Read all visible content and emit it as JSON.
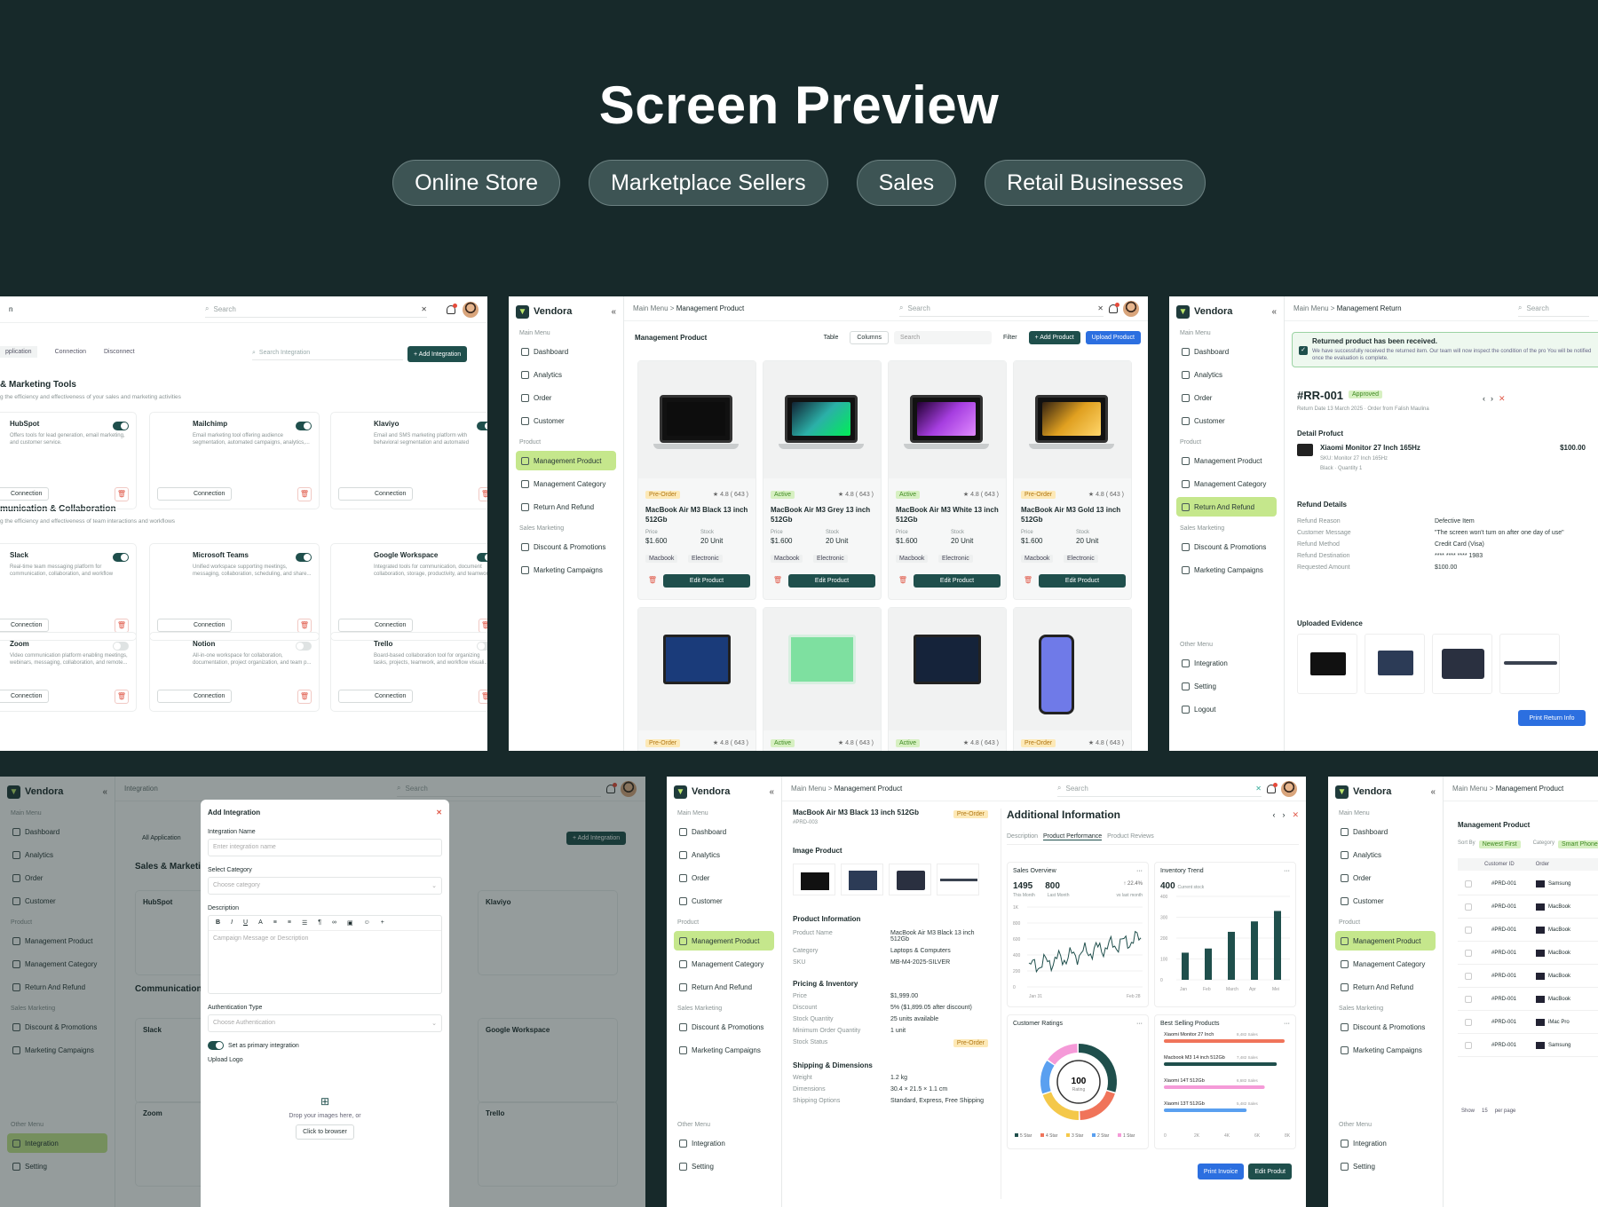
{
  "hero": {
    "title": "Screen Preview",
    "chips": [
      "Online Store",
      "Marketplace Sellers",
      "Sales",
      "Retail Businesses"
    ]
  },
  "brand": "Vendora",
  "nav": {
    "main_menu": "Main Menu",
    "dashboard": "Dashboard",
    "analytics": "Analytics",
    "order": "Order",
    "customer": "Customer",
    "product": "Product",
    "mgmt_product": "Management Product",
    "mgmt_category": "Management Category",
    "return_refund": "Return And Refund",
    "sales_marketing": "Sales Marketing",
    "discount": "Discount & Promotions",
    "campaigns": "Marketing Campaigns",
    "other_menu": "Other Menu",
    "integration": "Integration",
    "setting": "Setting",
    "logout": "Logout"
  },
  "search": "Search",
  "integrations": {
    "tabs": [
      "pplication",
      "Connection",
      "Disconnect"
    ],
    "search_placeholder": "Search Integration",
    "add_button": "+ Add Integration",
    "section1_title": "& Marketing Tools",
    "section1_desc": "g the efficiency and effectiveness of your sales and marketing activities",
    "section2_title": "munication & Collaboration",
    "section2_desc": "g the efficiency and effectiveness of team interactions and workflows",
    "connection_label": "Connection",
    "cards": [
      {
        "name": "HubSpot",
        "desc": "Offers tools for lead generation, email marketing, and customer service.",
        "on": true
      },
      {
        "name": "Mailchimp",
        "desc": "Email marketing tool offering audience segmentation, automated campaigns, analytics,...",
        "on": true
      },
      {
        "name": "Klaviyo",
        "desc": "Email and SMS marketing platform with behavioral segmentation and automated personalization.",
        "on": true
      },
      {
        "name": "Slack",
        "desc": "Real-time team messaging platform for communication, collaboration, and workflow coor...",
        "on": true
      },
      {
        "name": "Microsoft Teams",
        "desc": "Unified workspace supporting meetings, messaging, collaboration, scheduling, and share...",
        "on": true
      },
      {
        "name": "Google Workspace",
        "desc": "Integrated tools for communication, document collaboration, storage, productivity, and teamwor...",
        "on": true
      },
      {
        "name": "Zoom",
        "desc": "Video communication platform enabling meetings, webinars, messaging, collaboration, and remote...",
        "on": false
      },
      {
        "name": "Notion",
        "desc": "All-in-one workspace for collaboration, documentation, project organization, and team p...",
        "on": false
      },
      {
        "name": "Trello",
        "desc": "Board-based collaboration tool for organizing tasks, projects, teamwork, and workflow visuali...",
        "on": false
      }
    ]
  },
  "products": {
    "breadcrumb": "Main Menu",
    "current": "Management Product",
    "heading": "Management Product",
    "table": "Table",
    "columns": "Columns",
    "filter": "Filter",
    "add": "+ Add Product",
    "upload": "Upload Product",
    "edit": "Edit Product",
    "price_label": "Price",
    "stock_label": "Stock",
    "rating": "★ 4.8 ( 643 )",
    "items": [
      {
        "status": "Pre-Order",
        "name": "MacBook Air M3 Black 13 inch 512Gb",
        "price": "$1.600",
        "stock": "20 Unit",
        "tags": [
          "Macbook",
          "Electronic"
        ]
      },
      {
        "status": "Active",
        "name": "MacBook Air M3 Grey 13 inch 512Gb",
        "price": "$1.600",
        "stock": "20 Unit",
        "tags": [
          "Macbook",
          "Electronic"
        ]
      },
      {
        "status": "Active",
        "name": "MacBook Air M3 White 13 inch 512Gb",
        "price": "$1.600",
        "stock": "20 Unit",
        "tags": [
          "Macbook",
          "Electronic"
        ]
      },
      {
        "status": "Pre-Order",
        "name": "MacBook Air M3 Gold 13 inch 512Gb",
        "price": "$1.600",
        "stock": "20 Unit",
        "tags": [
          "Macbook",
          "Electronic"
        ]
      }
    ],
    "bottom_status": [
      "Pre-Order",
      "Active",
      "Active",
      "Pre-Order"
    ],
    "bottom_rating": "★ 4.8 ( 643 )"
  },
  "ret": {
    "current": "Management Return",
    "alert_title": "Returned product has been received.",
    "alert_body": "We have successfully received the returned item. Our team will now inspect the condition of the pro You will be notified once the evaluation is complete.",
    "id": "#RR-001",
    "status": "Approved",
    "meta": "Return Date  13 March 2025   ·   Order from  Falish Maulina",
    "detail_title": "Detail Profuct",
    "item": "Xiaomi Monitor 27 Inch 165Hz",
    "amount": "$100.00",
    "sku": "SKU: Monitor 27 Inch 165Hz",
    "variant": "Black  ·  Quantity 1",
    "refund_title": "Refund Details",
    "refund": [
      [
        "Refund Reason",
        "Defective Item"
      ],
      [
        "Customer Message",
        "\"The screen won't turn on after one day of use\""
      ],
      [
        "Refund Method",
        "Credit Card (Visa)"
      ],
      [
        "Refund Destination",
        "**** **** **** 1983"
      ],
      [
        "Requested Amount",
        "$100.00"
      ]
    ],
    "evidence": "Uploaded Evidence",
    "print": "Print Return Info"
  },
  "modal": {
    "bg_title": "Integration",
    "title": "Add Integration",
    "name_label": "Integration Name",
    "name_ph": "Enter integration name",
    "cat_label": "Select Category",
    "cat_ph": "Choose category",
    "desc_label": "Description",
    "desc_ph": "Campaign Message or Description",
    "auth_label": "Authentication Type",
    "auth_ph": "Choose Authentication",
    "primary": "Set as primary integration",
    "logo_label": "Upload Logo",
    "drop": "Drop your images here, or",
    "browse": "Click to browser",
    "bg_sales": "Sales & Marketi",
    "bg_comm": "Communication",
    "bg_all": "All Application"
  },
  "detail": {
    "product": "MacBook Air M3 Black 13 inch 512Gb",
    "code": "#PRD-003",
    "status": "Pre-Order",
    "image_title": "Image Product",
    "info_title": "Product Information",
    "info": [
      [
        "Product Name",
        "MacBook Air M3 Black 13 inch 512Gb"
      ],
      [
        "Category",
        "Laptops & Computers"
      ],
      [
        "SKU",
        "MB-M4-2025-SILVER"
      ]
    ],
    "pricing_title": "Pricing & Inventory",
    "pricing": [
      [
        "Price",
        "$1,999.00"
      ],
      [
        "Discount",
        "5% ($1,899.05 after discount)"
      ],
      [
        "Stock Quantity",
        "25 units available"
      ],
      [
        "Minimum Order Quantity",
        "1 unit"
      ],
      [
        "Stock Status",
        "Pre-Order"
      ]
    ],
    "ship_title": "Shipping & Dimensions",
    "ship": [
      [
        "Weight",
        "1.2 kg"
      ],
      [
        "Dimensions",
        "30.4 × 21.5 × 1.1 cm"
      ],
      [
        "Shipping Options",
        "Standard, Express, Free Shipping"
      ]
    ],
    "add_title": "Additional Information",
    "tabs": [
      "Description",
      "Product Performance",
      "Product Reviews"
    ],
    "sales_title": "Sales Overview",
    "sales_a": "1495",
    "sales_b": "800",
    "sales_delta": "↑ 22.4%",
    "sales_a_l": "This Month",
    "sales_b_l": "Last Month",
    "vs": "vs last month",
    "inv_title": "Inventory Trend",
    "inv_val": "400",
    "inv_sub": "Current stock",
    "inv_months": [
      "Jan",
      "Feb",
      "March",
      "Apr",
      "Mei"
    ],
    "ratings_title": "Customer Ratings",
    "rating_val": "100",
    "rating_l": "Rating",
    "stars": [
      "5 Star",
      "4 Star",
      "3 Star",
      "2 Star",
      "1 Star"
    ],
    "best_title": "Best Selling Products",
    "best": [
      [
        "Xiaomi Monitor 27 Inch",
        "8,482 Sales"
      ],
      [
        "Macbook M3 14 inch 512Gb",
        "7,482 Sales"
      ],
      [
        "Xiaomi 14T  512Gb",
        "6,682 Sales"
      ],
      [
        "Xiaomi 13T  512Gb",
        "5,482 Sales"
      ]
    ],
    "best_axis": [
      "0",
      "2K",
      "4K",
      "6K",
      "8K"
    ],
    "print": "Print Invoice",
    "edit": "Edit Produt"
  },
  "table": {
    "heading": "Management Product",
    "sort": "Sort By",
    "sort_val": "Newest First",
    "category": "Category",
    "cat_val": "Smart Phone",
    "cols": [
      "Customer ID",
      "Order"
    ],
    "ids": [
      "#PRD-001",
      "#PRD-001",
      "#PRD-001",
      "#PRD-001",
      "#PRD-001",
      "#PRD-001",
      "#PRD-001",
      "#PRD-001"
    ],
    "names": [
      "Samsung",
      "MacBook",
      "MacBook",
      "MacBook",
      "MacBook",
      "MacBook",
      "iMac Pro",
      "Samsung"
    ],
    "show": "Show",
    "per": "per page",
    "n": "15"
  },
  "chart_data": [
    {
      "type": "line",
      "title": "Sales Overview",
      "x": [
        "Jan 31",
        "Feb 28"
      ],
      "ylim": [
        0,
        1000
      ]
    },
    {
      "type": "bar",
      "title": "Inventory Trend",
      "categories": [
        "Jan",
        "Feb",
        "March",
        "Apr",
        "Mei"
      ],
      "values": [
        130,
        150,
        230,
        280,
        330
      ],
      "ylim": [
        0,
        400
      ]
    },
    {
      "type": "pie",
      "title": "Customer Ratings",
      "categories": [
        "5 Star",
        "4 Star",
        "3 Star",
        "2 Star",
        "1 Star"
      ],
      "values": [
        30,
        20,
        20,
        15,
        15
      ]
    },
    {
      "type": "bar",
      "title": "Best Selling Products",
      "categories": [
        "Xiaomi Monitor 27 Inch",
        "Macbook M3 14 inch 512Gb",
        "Xiaomi 14T  512Gb",
        "Xiaomi 13T  512Gb"
      ],
      "values": [
        8482,
        7482,
        6682,
        5482
      ],
      "xlim": [
        0,
        8000
      ]
    }
  ],
  "colors": {
    "bg": "#17292a",
    "accent": "#1f4f4c",
    "lime": "#c5e78c",
    "blue": "#2c6fe0"
  }
}
